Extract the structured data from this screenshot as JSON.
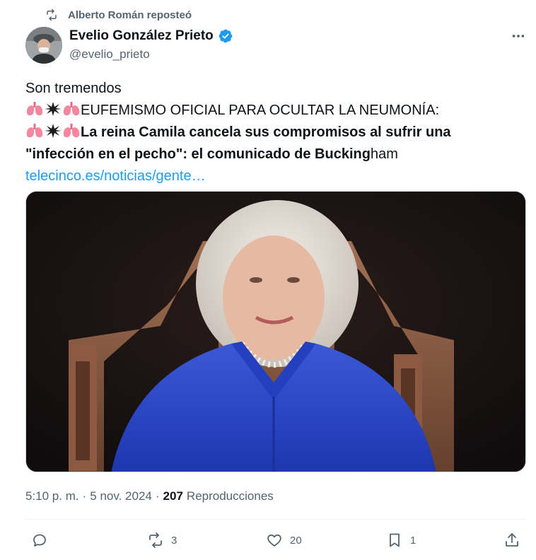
{
  "repost": {
    "icon": "repost-icon",
    "label": "Alberto Román reposteó"
  },
  "author": {
    "name": "Evelio González Prieto",
    "handle": "@evelio_prieto",
    "verified_icon": "verified-badge-icon"
  },
  "tweet": {
    "line1": "Son tremendos",
    "line2": "EUFEMISMO OFICIAL PARA OCULTAR LA NEUMONÍA:",
    "line3": "La reina Camila cancela sus compromisos al sufrir una",
    "line4_bold": "\"infección en el pecho\": el comunicado de Bucking",
    "line4_tail": "ham",
    "link": "telecinco.es/noticias/gente…",
    "emoji_icons": [
      "lungs-icon",
      "sparkle-icon"
    ]
  },
  "meta": {
    "time": "5:10 p. m.",
    "sep1": "·",
    "date": "5 nov. 2024",
    "sep2": "·",
    "views": "207",
    "views_label": "Reproducciones"
  },
  "actions": {
    "reply": {
      "icon": "reply-icon",
      "count": ""
    },
    "repost": {
      "icon": "repost-icon",
      "count": "3"
    },
    "like": {
      "icon": "heart-icon",
      "count": "20"
    },
    "bookmark": {
      "icon": "bookmark-icon",
      "count": "1"
    },
    "share": {
      "icon": "share-icon",
      "count": ""
    }
  },
  "colors": {
    "accent": "#1d9bf0",
    "muted": "#536471",
    "text": "#0f1419"
  }
}
